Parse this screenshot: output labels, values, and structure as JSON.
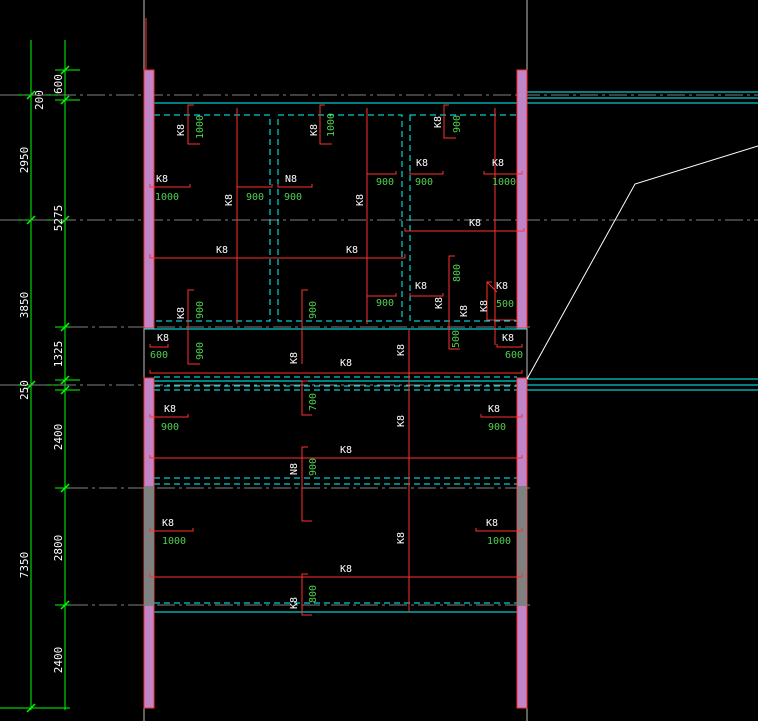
{
  "drawing": {
    "colors": {
      "background": "#000000",
      "dimension": "#00ff00",
      "slab_edge": "#00ffff",
      "rebar": "#ff3030",
      "wall": "#c084c8",
      "text": "#ffffff",
      "length_text": "#4fd14f",
      "axis": "#808080"
    },
    "dimensions": {
      "outer_total": [
        "7350"
      ],
      "inner": [
        "600",
        "200",
        "2950",
        "5275",
        "3850",
        "1325",
        "250",
        "2400",
        "2800",
        "2400"
      ]
    },
    "rebar_labels": {
      "code": "K8",
      "code_alt": "N8",
      "lengths": [
        "1000",
        "1000",
        "900",
        "1000",
        "900",
        "900",
        "900",
        "900",
        "1000",
        "800",
        "500",
        "900",
        "900",
        "900",
        "500",
        "600",
        "600",
        "700",
        "900",
        "900",
        "900",
        "900",
        "1000",
        "1000",
        "800"
      ]
    }
  }
}
